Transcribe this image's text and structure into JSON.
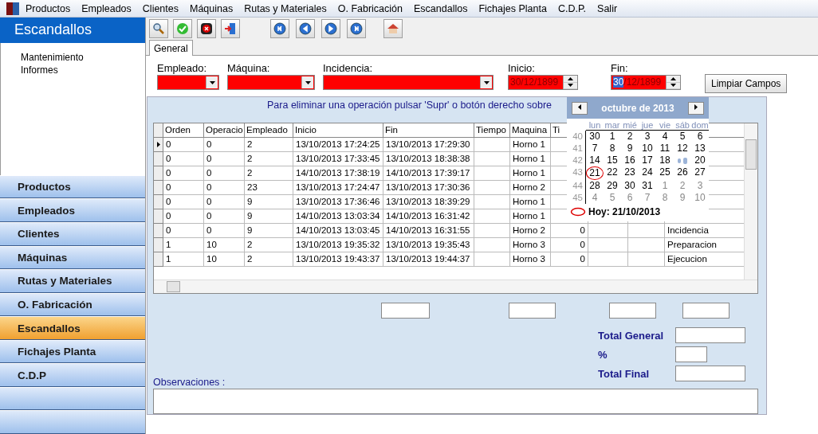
{
  "menu": [
    "Productos",
    "Empleados",
    "Clientes",
    "Máquinas",
    "Rutas y  Materiales",
    "O. Fabricación",
    "Escandallos",
    "Fichajes Planta",
    "C.D.P.",
    "Salir"
  ],
  "sidebar": {
    "title": "Escandallos",
    "links": [
      "Mantenimiento",
      "Informes"
    ],
    "items": [
      {
        "label": "Productos",
        "selected": false
      },
      {
        "label": "Empleados",
        "selected": false
      },
      {
        "label": "Clientes",
        "selected": false
      },
      {
        "label": "Máquinas",
        "selected": false
      },
      {
        "label": "Rutas y Materiales",
        "selected": false
      },
      {
        "label": "O. Fabricación",
        "selected": false
      },
      {
        "label": "Escandallos",
        "selected": true
      },
      {
        "label": "Fichajes Planta",
        "selected": false
      },
      {
        "label": "C.D.P",
        "selected": false
      }
    ]
  },
  "tabs": [
    {
      "label": "General",
      "selected": true
    }
  ],
  "filters": {
    "empleado": {
      "label": "Empleado:"
    },
    "maquina": {
      "label": "Máquina:"
    },
    "incidencia": {
      "label": "Incidencia:"
    },
    "inicio": {
      "label": "Inicio:",
      "value": "30/12/1899"
    },
    "fin": {
      "label": "Fin:",
      "selected_text": "30",
      "value_rest": "/12/1899"
    },
    "clear_button": "Limpiar Campos"
  },
  "hint": "Para eliminar una operación pulsar 'Supr' o botón derecho sobre",
  "table": {
    "columns": [
      "Orden",
      "Operacio",
      "Empleado",
      "Inicio",
      "Fin",
      "Tiempo",
      "Maquina",
      "Ti"
    ],
    "rows": [
      {
        "current": true,
        "orden": "0",
        "operacion": "0",
        "empleado": "2",
        "inicio": "13/10/2013 17:24:25",
        "fin": "13/10/2013 17:29:30",
        "maquina": "Horno 1"
      },
      {
        "current": false,
        "orden": "0",
        "operacion": "0",
        "empleado": "2",
        "inicio": "13/10/2013 17:33:45",
        "fin": "13/10/2013 18:38:38",
        "maquina": "Horno 1"
      },
      {
        "current": false,
        "orden": "0",
        "operacion": "0",
        "empleado": "2",
        "inicio": "14/10/2013 17:38:19",
        "fin": "14/10/2013 17:39:17",
        "maquina": "Horno 1"
      },
      {
        "current": false,
        "orden": "0",
        "operacion": "0",
        "empleado": "23",
        "inicio": "13/10/2013 17:24:47",
        "fin": "13/10/2013 17:30:36",
        "maquina": "Horno 2"
      },
      {
        "current": false,
        "orden": "0",
        "operacion": "0",
        "empleado": "9",
        "inicio": "13/10/2013 17:36:46",
        "fin": "13/10/2013 18:39:29",
        "maquina": "Horno 1"
      },
      {
        "current": false,
        "orden": "0",
        "operacion": "0",
        "empleado": "9",
        "inicio": "14/10/2013 13:03:34",
        "fin": "14/10/2013 16:31:42",
        "maquina": "Horno 1"
      },
      {
        "current": false,
        "orden": "0",
        "operacion": "0",
        "empleado": "9",
        "inicio": "14/10/2013 13:03:45",
        "fin": "14/10/2013 16:31:55",
        "maquina": "Horno 2",
        "column_9": "0",
        "column_12": "Incidencia"
      },
      {
        "current": false,
        "orden": "1",
        "operacion": "10",
        "empleado": "2",
        "inicio": "13/10/2013 19:35:32",
        "fin": "13/10/2013 19:35:43",
        "maquina": "Horno 3",
        "column_9": "0",
        "column_12": "Preparacion"
      },
      {
        "current": false,
        "orden": "1",
        "operacion": "10",
        "empleado": "2",
        "inicio": "13/10/2013 19:43:37",
        "fin": "13/10/2013 19:44:37",
        "maquina": "Horno 3",
        "column_9": "0",
        "column_12": "Ejecucion"
      }
    ]
  },
  "calendar": {
    "month": "octubre de 2013",
    "weekdays": [
      "lun",
      "mar",
      "mié",
      "jue",
      "vie",
      "sáb",
      "dom"
    ],
    "weeks": [
      {
        "number": "40",
        "days": [
          {
            "d": "30",
            "muted": false
          },
          {
            "d": "1",
            "muted": false
          },
          {
            "d": "2",
            "muted": false
          },
          {
            "d": "3",
            "muted": false
          },
          {
            "d": "4",
            "muted": false
          },
          {
            "d": "5",
            "muted": false
          },
          {
            "d": "6",
            "muted": false
          }
        ]
      },
      {
        "number": "41",
        "days": [
          {
            "d": "7",
            "muted": false
          },
          {
            "d": "8",
            "muted": false
          },
          {
            "d": "9",
            "muted": false
          },
          {
            "d": "10",
            "muted": false
          },
          {
            "d": "11",
            "muted": false
          },
          {
            "d": "12",
            "muted": false
          },
          {
            "d": "13",
            "muted": false
          }
        ]
      },
      {
        "number": "42",
        "days": [
          {
            "d": "14",
            "muted": false
          },
          {
            "d": "15",
            "muted": false
          },
          {
            "d": "16",
            "muted": false
          },
          {
            "d": "17",
            "muted": false
          },
          {
            "d": "18",
            "muted": false
          },
          {
            "kind": "cursor"
          },
          {
            "d": "20",
            "muted": false
          }
        ]
      },
      {
        "number": "43",
        "days": [
          {
            "d": "21",
            "muted": false,
            "today": true
          },
          {
            "d": "22",
            "muted": false
          },
          {
            "d": "23",
            "muted": false
          },
          {
            "d": "24",
            "muted": false
          },
          {
            "d": "25",
            "muted": false
          },
          {
            "d": "26",
            "muted": false
          },
          {
            "d": "27",
            "muted": false
          }
        ]
      },
      {
        "number": "44",
        "days": [
          {
            "d": "28",
            "muted": false
          },
          {
            "d": "29",
            "muted": false
          },
          {
            "d": "30",
            "muted": false
          },
          {
            "d": "31",
            "muted": false
          },
          {
            "d": "1",
            "muted": true
          },
          {
            "d": "2",
            "muted": true
          },
          {
            "d": "3",
            "muted": true
          }
        ]
      },
      {
        "number": "45",
        "days": [
          {
            "d": "4",
            "muted": true
          },
          {
            "d": "5",
            "muted": true
          },
          {
            "d": "6",
            "muted": true
          },
          {
            "d": "7",
            "muted": true
          },
          {
            "d": "8",
            "muted": true
          },
          {
            "d": "9",
            "muted": true
          },
          {
            "d": "10",
            "muted": true
          }
        ]
      }
    ],
    "today": "Hoy: 21/10/2013"
  },
  "totals": {
    "total_general": "Total General",
    "percent": "%",
    "total_final": "Total Final"
  },
  "observations_label": "Observaciones :"
}
